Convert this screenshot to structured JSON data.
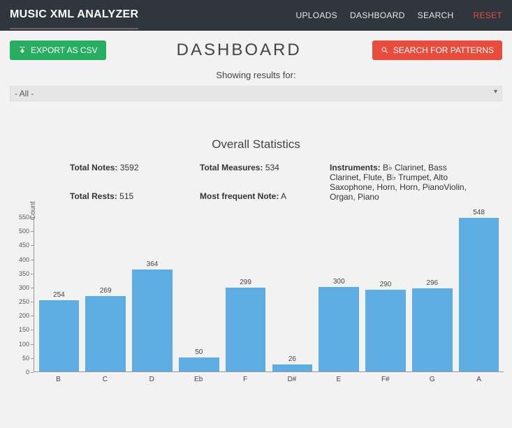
{
  "nav": {
    "brand": "MUSIC XML ANALYZER",
    "links": [
      "UPLOADS",
      "DASHBOARD",
      "SEARCH"
    ],
    "reset": "RESET"
  },
  "toolbar": {
    "export_label": "EXPORT AS CSV",
    "title": "DASHBOARD",
    "search_label": "SEARCH FOR PATTERNS"
  },
  "filter": {
    "label": "Showing results for:",
    "selected": "- All -"
  },
  "stats": {
    "title": "Overall Statistics",
    "total_notes_label": "Total Notes:",
    "total_notes": "3592",
    "total_measures_label": "Total Measures:",
    "total_measures": "534",
    "instruments_label": "Instruments:",
    "instruments": "B♭ Clarinet, Bass Clarinet, Flute, B♭ Trumpet, Alto Saxophone, Horn, Horn, PianoViolin, Organ, Piano",
    "total_rests_label": "Total Rests:",
    "total_rests": "515",
    "freq_note_label": "Most frequent Note:",
    "freq_note": "A"
  },
  "chart_data": {
    "type": "bar",
    "categories": [
      "B",
      "C",
      "D",
      "Eb",
      "F",
      "D#",
      "E",
      "F#",
      "G",
      "A"
    ],
    "values": [
      254,
      269,
      364,
      50,
      299,
      26,
      300,
      290,
      296,
      548
    ],
    "ylabel": "Count",
    "xlabel": "",
    "title": "",
    "ylim": [
      0,
      550
    ],
    "yticks": [
      0,
      50,
      100,
      150,
      200,
      250,
      300,
      350,
      400,
      450,
      500,
      550
    ]
  }
}
